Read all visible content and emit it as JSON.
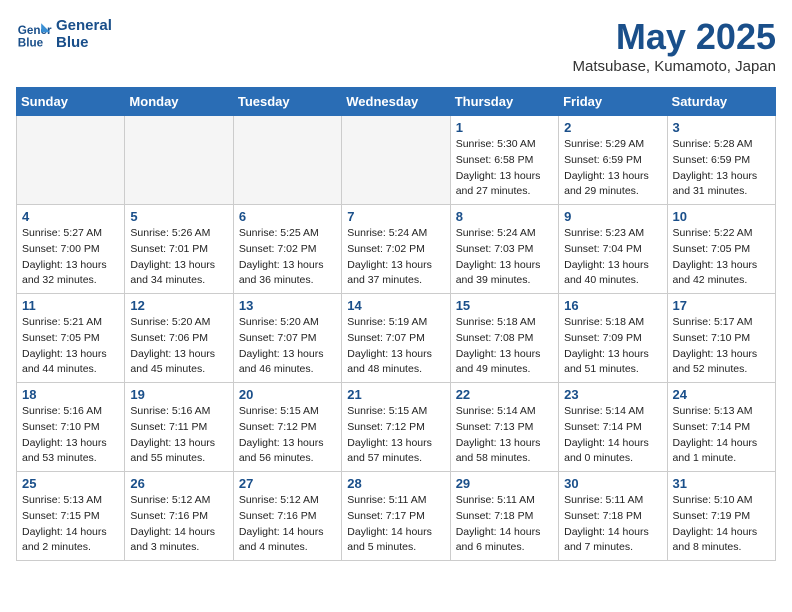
{
  "header": {
    "logo_line1": "General",
    "logo_line2": "Blue",
    "month": "May 2025",
    "location": "Matsubase, Kumamoto, Japan"
  },
  "weekdays": [
    "Sunday",
    "Monday",
    "Tuesday",
    "Wednesday",
    "Thursday",
    "Friday",
    "Saturday"
  ],
  "weeks": [
    [
      {
        "day": "",
        "empty": true
      },
      {
        "day": "",
        "empty": true
      },
      {
        "day": "",
        "empty": true
      },
      {
        "day": "",
        "empty": true
      },
      {
        "day": "1",
        "sunrise": "5:30 AM",
        "sunset": "6:58 PM",
        "daylight": "13 hours and 27 minutes."
      },
      {
        "day": "2",
        "sunrise": "5:29 AM",
        "sunset": "6:59 PM",
        "daylight": "13 hours and 29 minutes."
      },
      {
        "day": "3",
        "sunrise": "5:28 AM",
        "sunset": "6:59 PM",
        "daylight": "13 hours and 31 minutes."
      }
    ],
    [
      {
        "day": "4",
        "sunrise": "5:27 AM",
        "sunset": "7:00 PM",
        "daylight": "13 hours and 32 minutes."
      },
      {
        "day": "5",
        "sunrise": "5:26 AM",
        "sunset": "7:01 PM",
        "daylight": "13 hours and 34 minutes."
      },
      {
        "day": "6",
        "sunrise": "5:25 AM",
        "sunset": "7:02 PM",
        "daylight": "13 hours and 36 minutes."
      },
      {
        "day": "7",
        "sunrise": "5:24 AM",
        "sunset": "7:02 PM",
        "daylight": "13 hours and 37 minutes."
      },
      {
        "day": "8",
        "sunrise": "5:24 AM",
        "sunset": "7:03 PM",
        "daylight": "13 hours and 39 minutes."
      },
      {
        "day": "9",
        "sunrise": "5:23 AM",
        "sunset": "7:04 PM",
        "daylight": "13 hours and 40 minutes."
      },
      {
        "day": "10",
        "sunrise": "5:22 AM",
        "sunset": "7:05 PM",
        "daylight": "13 hours and 42 minutes."
      }
    ],
    [
      {
        "day": "11",
        "sunrise": "5:21 AM",
        "sunset": "7:05 PM",
        "daylight": "13 hours and 44 minutes."
      },
      {
        "day": "12",
        "sunrise": "5:20 AM",
        "sunset": "7:06 PM",
        "daylight": "13 hours and 45 minutes."
      },
      {
        "day": "13",
        "sunrise": "5:20 AM",
        "sunset": "7:07 PM",
        "daylight": "13 hours and 46 minutes."
      },
      {
        "day": "14",
        "sunrise": "5:19 AM",
        "sunset": "7:07 PM",
        "daylight": "13 hours and 48 minutes."
      },
      {
        "day": "15",
        "sunrise": "5:18 AM",
        "sunset": "7:08 PM",
        "daylight": "13 hours and 49 minutes."
      },
      {
        "day": "16",
        "sunrise": "5:18 AM",
        "sunset": "7:09 PM",
        "daylight": "13 hours and 51 minutes."
      },
      {
        "day": "17",
        "sunrise": "5:17 AM",
        "sunset": "7:10 PM",
        "daylight": "13 hours and 52 minutes."
      }
    ],
    [
      {
        "day": "18",
        "sunrise": "5:16 AM",
        "sunset": "7:10 PM",
        "daylight": "13 hours and 53 minutes."
      },
      {
        "day": "19",
        "sunrise": "5:16 AM",
        "sunset": "7:11 PM",
        "daylight": "13 hours and 55 minutes."
      },
      {
        "day": "20",
        "sunrise": "5:15 AM",
        "sunset": "7:12 PM",
        "daylight": "13 hours and 56 minutes."
      },
      {
        "day": "21",
        "sunrise": "5:15 AM",
        "sunset": "7:12 PM",
        "daylight": "13 hours and 57 minutes."
      },
      {
        "day": "22",
        "sunrise": "5:14 AM",
        "sunset": "7:13 PM",
        "daylight": "13 hours and 58 minutes."
      },
      {
        "day": "23",
        "sunrise": "5:14 AM",
        "sunset": "7:14 PM",
        "daylight": "14 hours and 0 minutes."
      },
      {
        "day": "24",
        "sunrise": "5:13 AM",
        "sunset": "7:14 PM",
        "daylight": "14 hours and 1 minute."
      }
    ],
    [
      {
        "day": "25",
        "sunrise": "5:13 AM",
        "sunset": "7:15 PM",
        "daylight": "14 hours and 2 minutes."
      },
      {
        "day": "26",
        "sunrise": "5:12 AM",
        "sunset": "7:16 PM",
        "daylight": "14 hours and 3 minutes."
      },
      {
        "day": "27",
        "sunrise": "5:12 AM",
        "sunset": "7:16 PM",
        "daylight": "14 hours and 4 minutes."
      },
      {
        "day": "28",
        "sunrise": "5:11 AM",
        "sunset": "7:17 PM",
        "daylight": "14 hours and 5 minutes."
      },
      {
        "day": "29",
        "sunrise": "5:11 AM",
        "sunset": "7:18 PM",
        "daylight": "14 hours and 6 minutes."
      },
      {
        "day": "30",
        "sunrise": "5:11 AM",
        "sunset": "7:18 PM",
        "daylight": "14 hours and 7 minutes."
      },
      {
        "day": "31",
        "sunrise": "5:10 AM",
        "sunset": "7:19 PM",
        "daylight": "14 hours and 8 minutes."
      }
    ]
  ]
}
